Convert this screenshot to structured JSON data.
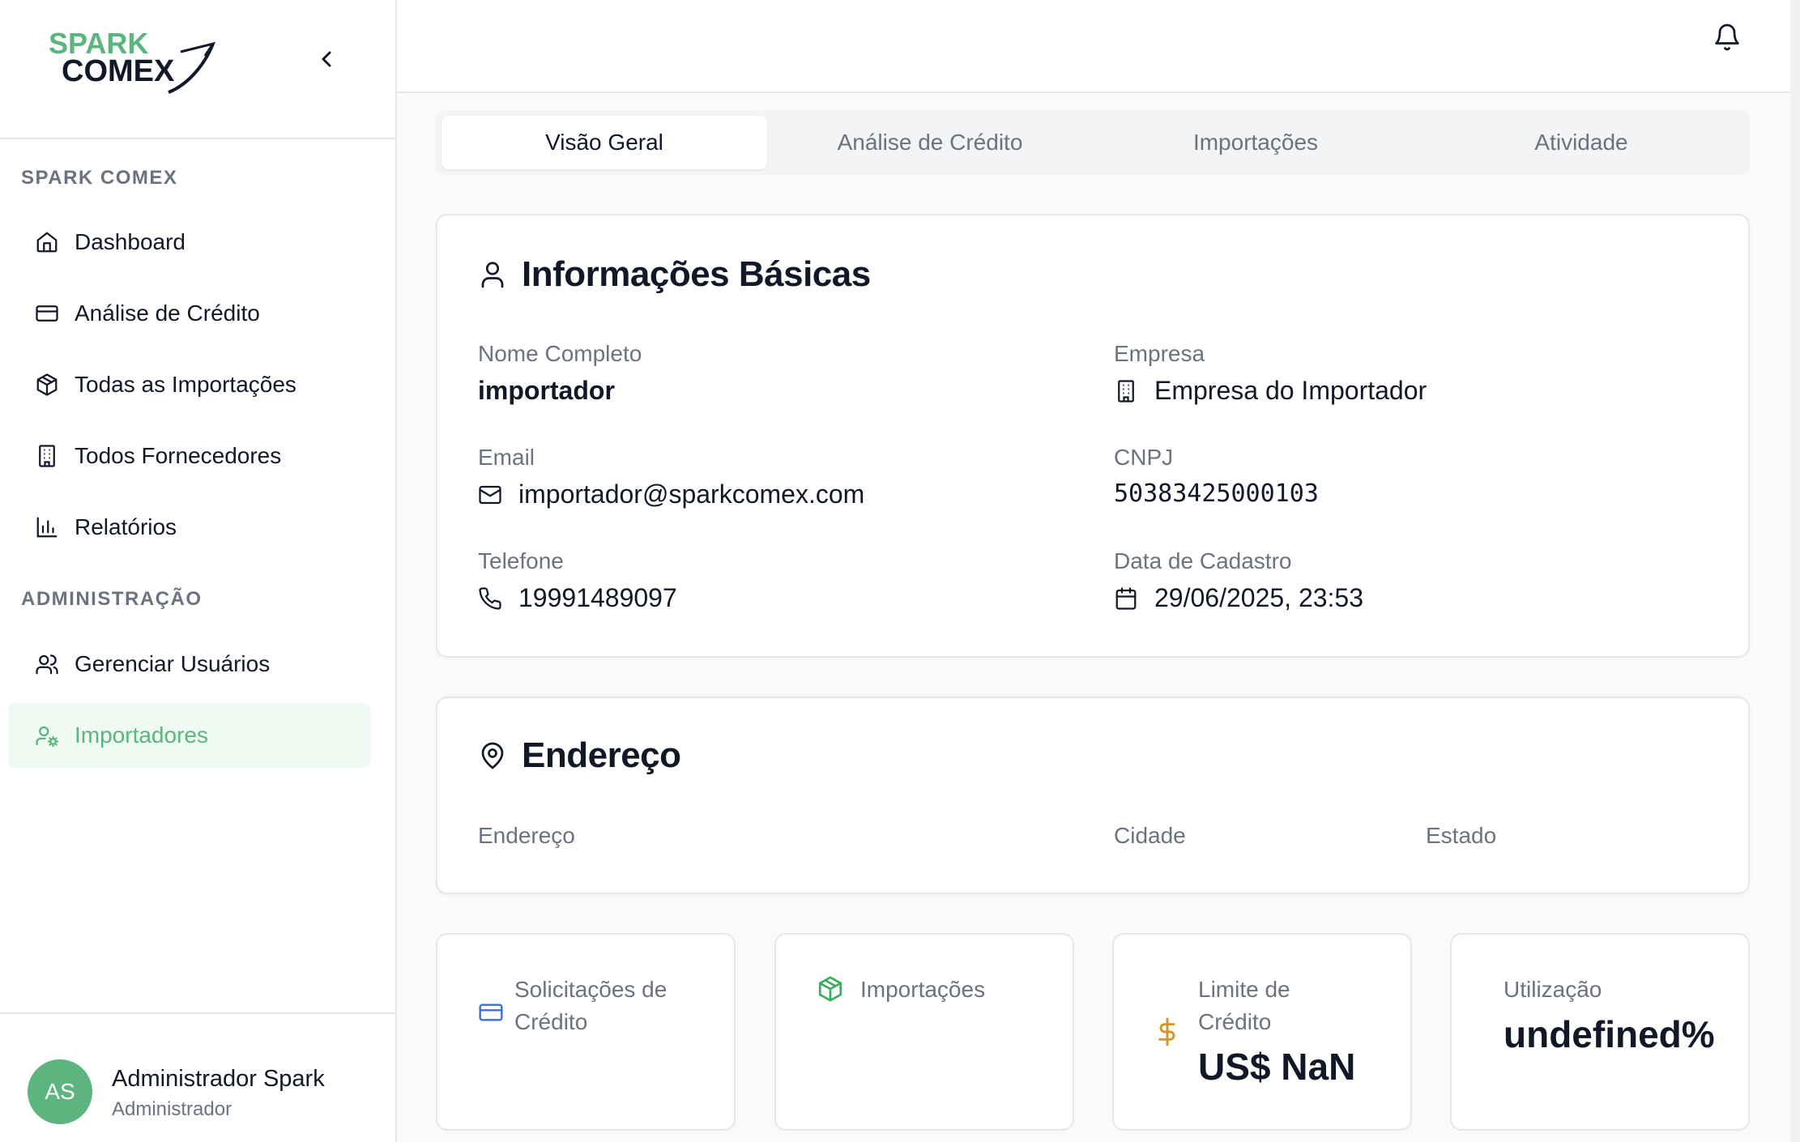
{
  "brand": {
    "logo_line1": "SPARK",
    "logo_line2": "COMEX",
    "accent": "#5cb57f"
  },
  "sidebar": {
    "section1": "SPARK COMEX",
    "items": [
      {
        "label": "Dashboard",
        "icon": "home-icon"
      },
      {
        "label": "Análise de Crédito",
        "icon": "credit-card-icon"
      },
      {
        "label": "Todas as Importações",
        "icon": "package-icon"
      },
      {
        "label": "Todos Fornecedores",
        "icon": "building-icon"
      },
      {
        "label": "Relatórios",
        "icon": "bar-chart-icon"
      }
    ],
    "section2": "ADMINISTRAÇÃO",
    "admin_items": [
      {
        "label": "Gerenciar Usuários",
        "icon": "users-icon"
      },
      {
        "label": "Importadores",
        "icon": "user-cog-icon",
        "active": true
      }
    ],
    "user": {
      "initials": "AS",
      "name": "Administrador Spark",
      "role": "Administrador"
    }
  },
  "tabs": [
    {
      "label": "Visão Geral",
      "active": true
    },
    {
      "label": "Análise de Crédito"
    },
    {
      "label": "Importações"
    },
    {
      "label": "Atividade"
    }
  ],
  "basic_info": {
    "title": "Informações Básicas",
    "name_label": "Nome Completo",
    "name_value": "importador",
    "company_label": "Empresa",
    "company_value": "Empresa do Importador",
    "email_label": "Email",
    "email_value": "importador@sparkcomex.com",
    "cnpj_label": "CNPJ",
    "cnpj_value": "50383425000103",
    "phone_label": "Telefone",
    "phone_value": "19991489097",
    "date_label": "Data de Cadastro",
    "date_value": "29/06/2025, 23:53"
  },
  "address": {
    "title": "Endereço",
    "address_label": "Endereço",
    "city_label": "Cidade",
    "state_label": "Estado"
  },
  "stats": {
    "credit_requests_label_1": "Solicitações de",
    "credit_requests_label_2": "Crédito",
    "imports_label": "Importações",
    "limit_label_1": "Limite de",
    "limit_label_2": "Crédito",
    "limit_value": "US$ NaN",
    "usage_label": "Utilização",
    "usage_value": "undefined%"
  }
}
